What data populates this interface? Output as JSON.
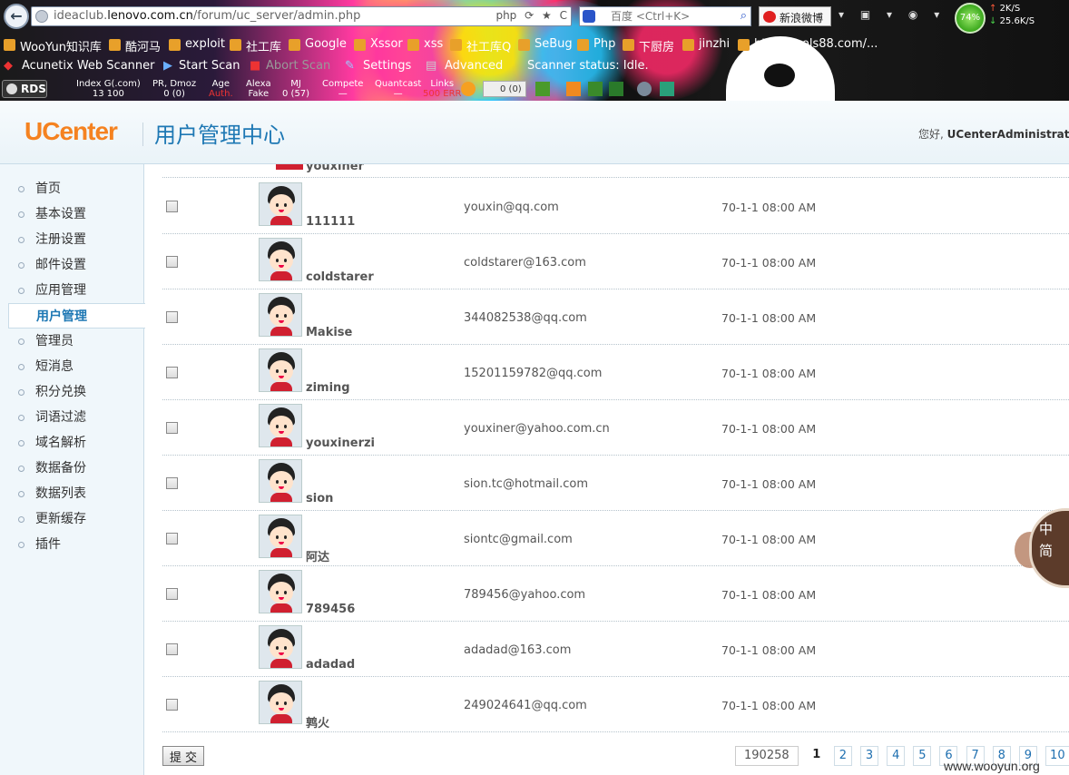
{
  "browser": {
    "back_glyph": "←",
    "url_prefix": "ideaclub.",
    "url_domain": "lenovo.com.cn",
    "url_path": "/forum/uc_server/admin.php",
    "url_tools": [
      "php",
      "⟳",
      "★",
      "C"
    ],
    "search_placeholder": "百度 <Ctrl+K>",
    "weibo_label": "新浪微博",
    "net_percent": "74%",
    "net_up": "2K/S",
    "net_down": "25.6K/S",
    "bookmarks": [
      "WooYun知识库",
      "酷河马",
      "exploit",
      "社工库",
      "Google",
      "Xssor",
      "xss",
      "社工库Q",
      "SeBug",
      "Php",
      "下厨房",
      "jinzhi",
      "http://tools88.com/..."
    ],
    "scanner": {
      "name": "Acunetix Web Scanner",
      "start": "Start Scan",
      "abort": "Abort Scan",
      "settings": "Settings",
      "advanced": "Advanced",
      "status": "Scanner status: Idle."
    },
    "seo": [
      {
        "label": "Index G(.com)",
        "value": "13 100"
      },
      {
        "label": "PR, Dmoz",
        "value": "0 (0)"
      },
      {
        "label": "Age",
        "value": "Auth."
      },
      {
        "label": "Alexa",
        "value": "Fake"
      },
      {
        "label": "MJ",
        "value": "0 (57)"
      },
      {
        "label": "Compete",
        "value": "—"
      },
      {
        "label": "Quantcast",
        "value": "—"
      },
      {
        "label": "Links",
        "value": "500 ERR"
      }
    ],
    "rds_label": "RDS",
    "gplus": "0 (0)"
  },
  "header": {
    "logo": "UCenter",
    "title": "用户管理中心",
    "greeting": "您好,",
    "user": "UCenterAdministrator"
  },
  "sidebar": {
    "items": [
      {
        "label": "首页"
      },
      {
        "label": "基本设置"
      },
      {
        "label": "注册设置"
      },
      {
        "label": "邮件设置"
      },
      {
        "label": "应用管理"
      },
      {
        "label": "用户管理"
      },
      {
        "label": "管理员"
      },
      {
        "label": "短消息"
      },
      {
        "label": "积分兑换"
      },
      {
        "label": "词语过滤"
      },
      {
        "label": "域名解析"
      },
      {
        "label": "数据备份"
      },
      {
        "label": "数据列表"
      },
      {
        "label": "更新缓存"
      },
      {
        "label": "插件"
      }
    ],
    "active": "用户管理"
  },
  "users": {
    "partial_name": "youxiner",
    "rows": [
      {
        "name": "111111",
        "email": "youxin@qq.com",
        "date": "70-1-1 08:00 AM"
      },
      {
        "name": "coldstarer",
        "email": "coldstarer@163.com",
        "date": "70-1-1 08:00 AM"
      },
      {
        "name": "Makise",
        "email": "344082538@qq.com",
        "date": "70-1-1 08:00 AM"
      },
      {
        "name": "ziming",
        "email": "15201159782@qq.com",
        "date": "70-1-1 08:00 AM"
      },
      {
        "name": "youxinerzi",
        "email": "youxiner@yahoo.com.cn",
        "date": "70-1-1 08:00 AM"
      },
      {
        "name": "sion",
        "email": "sion.tc@hotmail.com",
        "date": "70-1-1 08:00 AM"
      },
      {
        "name": "阿达",
        "email": "siontc@gmail.com",
        "date": "70-1-1 08:00 AM"
      },
      {
        "name": "789456",
        "email": "789456@yahoo.com",
        "date": "70-1-1 08:00 AM"
      },
      {
        "name": "adadad",
        "email": "adadad@163.com",
        "date": "70-1-1 08:00 AM"
      },
      {
        "name": "鹑火",
        "email": "249024641@qq.com",
        "date": "70-1-1 08:00 AM"
      }
    ]
  },
  "footer": {
    "submit": "提 交",
    "total": "190258",
    "current_page": "1",
    "pages": [
      "2",
      "3",
      "4",
      "5",
      "6",
      "7",
      "8",
      "9",
      "10"
    ],
    "next": "››"
  },
  "ime": {
    "line1": "中",
    "line2": "简"
  },
  "watermark": "www.wooyun.org",
  "colors": {
    "logo": "#f58220",
    "title": "#1e78b4",
    "sidebar_bg": "#f0f7fb",
    "link": "#1e6fb0"
  }
}
